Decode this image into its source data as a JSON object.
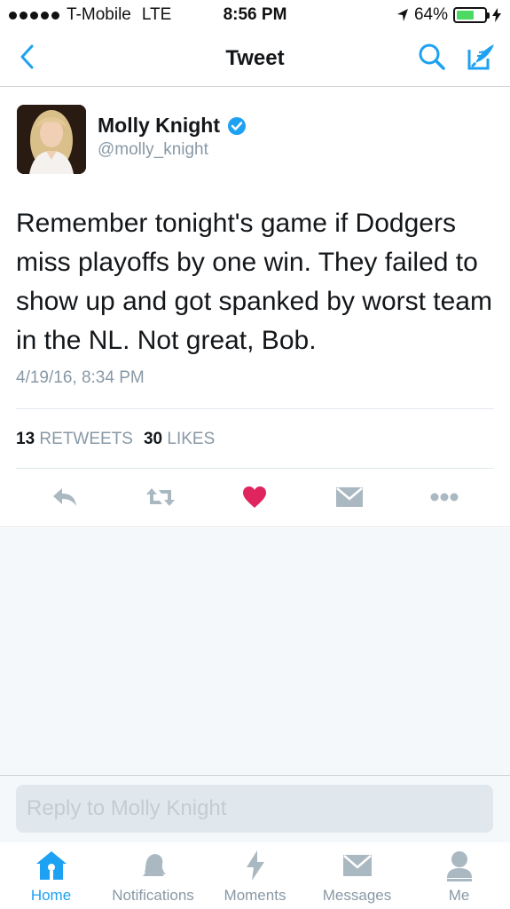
{
  "status_bar": {
    "carrier": "T-Mobile",
    "network": "LTE",
    "time": "8:56 PM",
    "battery_text": "64%",
    "battery_level": 0.64
  },
  "nav": {
    "title": "Tweet",
    "back_icon": "chevron-left-icon",
    "search_icon": "search-icon",
    "compose_icon": "compose-icon"
  },
  "tweet": {
    "author_name": "Molly Knight",
    "author_handle": "@molly_knight",
    "verified": true,
    "text": "Remember tonight's game if Dodgers miss playoffs by one win. They failed to show up and got spanked by worst team in the NL. Not great, Bob.",
    "timestamp": "4/19/16, 8:34 PM",
    "retweets_count": "13",
    "retweets_label": "RETWEETS",
    "likes_count": "30",
    "likes_label": "LIKES",
    "liked": true
  },
  "actions": [
    {
      "name": "reply",
      "icon": "reply-icon"
    },
    {
      "name": "retweet",
      "icon": "retweet-icon"
    },
    {
      "name": "like",
      "icon": "heart-icon"
    },
    {
      "name": "message",
      "icon": "envelope-icon"
    },
    {
      "name": "more",
      "icon": "more-icon"
    }
  ],
  "reply": {
    "placeholder": "Reply to Molly Knight"
  },
  "tabs": [
    {
      "label": "Home",
      "icon": "home-icon",
      "active": true
    },
    {
      "label": "Notifications",
      "icon": "bell-icon",
      "active": false
    },
    {
      "label": "Moments",
      "icon": "lightning-icon",
      "active": false
    },
    {
      "label": "Messages",
      "icon": "envelope-icon",
      "active": false
    },
    {
      "label": "Me",
      "icon": "person-icon",
      "active": false
    }
  ],
  "colors": {
    "accent": "#1da1f2",
    "heart": "#e0245e",
    "muted": "#8899a6",
    "icon_gray": "#aab8c2"
  }
}
